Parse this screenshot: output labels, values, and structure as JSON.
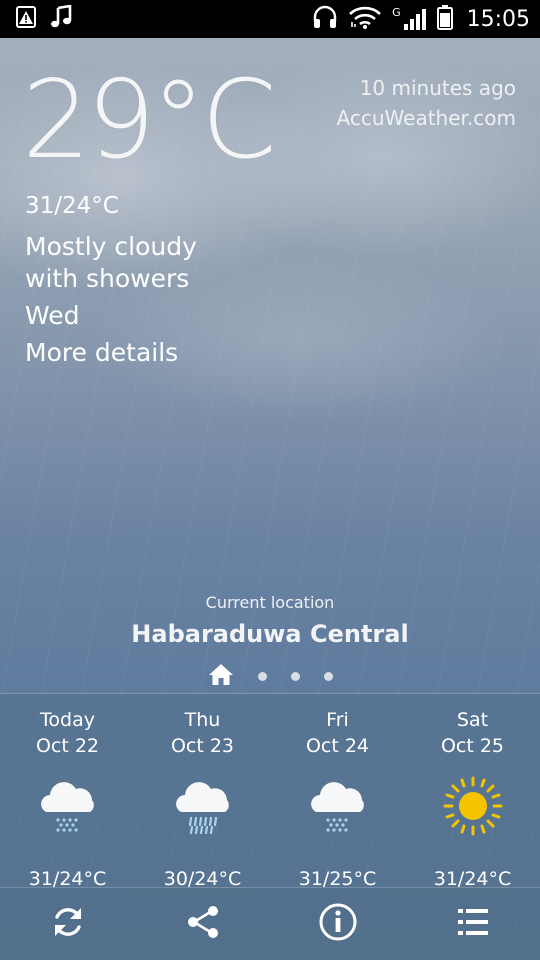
{
  "status_bar": {
    "time": "15:05",
    "network_label": "G",
    "left_icons": [
      "alert-icon",
      "music-note-icon"
    ],
    "right_icons": [
      "headphones-icon",
      "wifi-icon",
      "signal-icon",
      "battery-icon"
    ]
  },
  "current": {
    "temperature": "29°C",
    "updated": "10 minutes ago",
    "source": "AccuWeather.com",
    "hi_lo": "31/24°C",
    "condition_line1": "Mostly cloudy",
    "condition_line2": "with showers",
    "day": "Wed",
    "more_details": "More details"
  },
  "location": {
    "label": "Current location",
    "name": "Habaraduwa Central",
    "pages": 4,
    "active_page": 0
  },
  "forecast": [
    {
      "day": "Today",
      "date": "Oct 22",
      "icon": "cloud-rain-light-icon",
      "temp": "31/24°C"
    },
    {
      "day": "Thu",
      "date": "Oct 23",
      "icon": "cloud-rain-heavy-icon",
      "temp": "30/24°C"
    },
    {
      "day": "Fri",
      "date": "Oct 24",
      "icon": "cloud-rain-light-icon",
      "temp": "31/25°C"
    },
    {
      "day": "Sat",
      "date": "Oct 25",
      "icon": "sun-icon",
      "temp": "31/24°C"
    }
  ],
  "toolbar": {
    "icons": [
      "refresh-icon",
      "share-icon",
      "info-icon",
      "menu-list-icon"
    ]
  },
  "colors": {
    "sun": "#f5c400",
    "rain": "#a9d4f2",
    "status_bar": "#000000"
  }
}
